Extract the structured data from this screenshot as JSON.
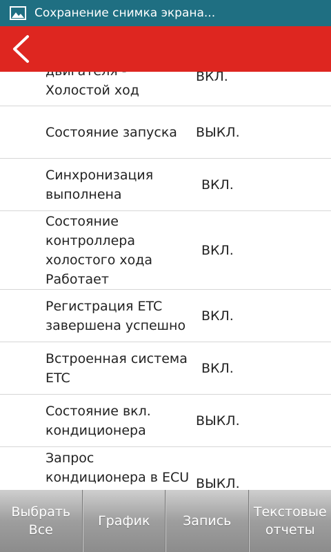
{
  "status_bar": {
    "notification_icon": "image-icon",
    "notification_text": "Сохранение снимка экрана..."
  },
  "app_bar": {
    "back_icon": "chevron-left-icon",
    "accent_color": "#de2620"
  },
  "rows": [
    {
      "name": "двигателя -\nХолостой ход",
      "value": "ВКЛ."
    },
    {
      "name": "Состояние запуска",
      "value": "ВЫКЛ."
    },
    {
      "name": "Синхронизация\nвыполнена",
      "value": "ВКЛ."
    },
    {
      "name": "Состояние\nконтроллера\nхолостого хода\nРаботает",
      "value": "ВКЛ."
    },
    {
      "name": "Регистрация ETC\nзавершена успешно",
      "value": "ВКЛ."
    },
    {
      "name": "Встроенная система\nETC",
      "value": "ВКЛ."
    },
    {
      "name": "Состояние вкл.\nкондиционера",
      "value": "ВЫКЛ."
    },
    {
      "name": "Запрос\nкондиционера в ECU",
      "value": "ВЫКЛ."
    }
  ],
  "toolbar": {
    "select_all": "Выбрать Все",
    "graph": "График",
    "record": "Запись",
    "text_reports": "Текстовые\nотчеты"
  }
}
